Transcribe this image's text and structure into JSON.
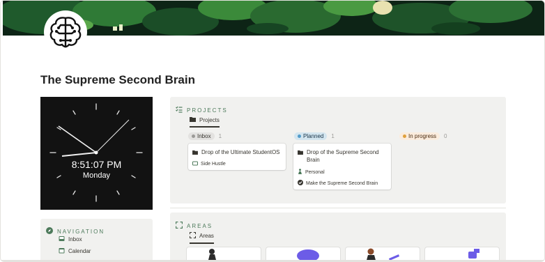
{
  "page": {
    "title": "The Supreme Second Brain"
  },
  "clock": {
    "time": "8:51:07 PM",
    "day": "Monday"
  },
  "navigation": {
    "heading": "NAVIGATION",
    "items": [
      {
        "label": "Inbox",
        "icon": "inbox-icon"
      },
      {
        "label": "Calendar",
        "icon": "calendar-icon"
      }
    ]
  },
  "projects": {
    "heading": "PROJECTS",
    "view_tab": "Projects",
    "groups": [
      {
        "label": "Inbox",
        "count": "1",
        "color": "#9b9a97",
        "bg": "#e3e2e0"
      },
      {
        "label": "Planned",
        "count": "1",
        "color": "#529cca",
        "bg": "#d3e5ef"
      },
      {
        "label": "In progress",
        "count": "0",
        "color": "#e0a03c",
        "bg": "#fbecdd"
      }
    ],
    "cards": [
      {
        "title": "Drop of the Ultimate StudentOS",
        "area": "Side Hustle"
      },
      {
        "title": "Drop of the Supreme Second Brain",
        "area": "Personal",
        "task": "Make the Supreme Second Brain"
      }
    ]
  },
  "areas": {
    "heading": "AREAS",
    "view_tab": "Areas"
  },
  "colors": {
    "accent": "#4d7a5b",
    "panel_bg": "#f1f1ef"
  }
}
